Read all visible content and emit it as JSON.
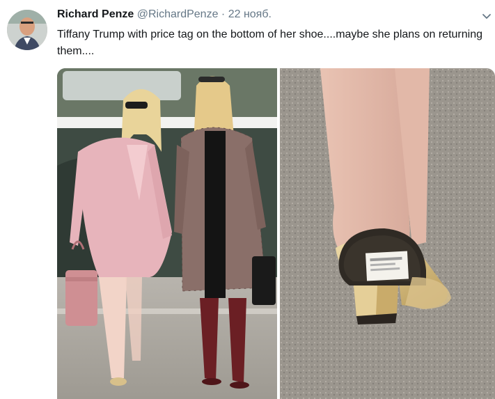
{
  "tweet": {
    "author_name": "Richard Penze",
    "author_handle": "@RichardPenze",
    "separator": "·",
    "date": "22 нояб.",
    "text": "Tiffany Trump with price tag on the bottom of her shoe....maybe she plans on returning them....",
    "icons": {
      "avatar": "profile-photo",
      "menu": "chevron-down-icon"
    },
    "media": [
      {
        "name": "photo-two-women-walking",
        "alt_visible": ""
      },
      {
        "name": "photo-shoe-heel-closeup",
        "alt_visible": ""
      }
    ],
    "colors": {
      "name": "#14171a",
      "muted": "#657786",
      "coat_pink": "#e7b4bb",
      "coat_plaid": "#8a6f69",
      "boots": "#6b1f24",
      "shoe_gold": "#d8c08a"
    }
  }
}
